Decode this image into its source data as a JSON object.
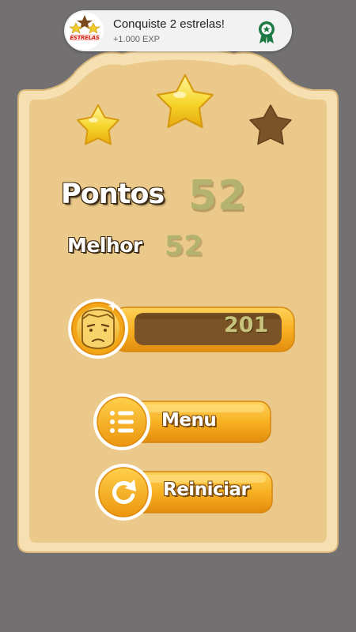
{
  "toast": {
    "logo_text": "ESTRELAS",
    "title": "Conquiste 2 estrelas!",
    "subtitle": "+1.000 EXP",
    "badge_icon": "award-ribbon-icon"
  },
  "result": {
    "stars_earned": 2,
    "stars_total": 3
  },
  "score": {
    "label": "Pontos",
    "value": "52"
  },
  "best": {
    "label": "Melhor",
    "value": "52"
  },
  "coins": {
    "value": "201",
    "icon": "coin-face-icon"
  },
  "buttons": {
    "menu_label": "Menu",
    "menu_icon": "list-icon",
    "restart_label": "Reiniciar",
    "restart_icon": "restart-icon"
  },
  "colors": {
    "background": "#727071",
    "panel": "#ebc98a",
    "panel_border": "#f4deaf",
    "score_value": "#b3b36f",
    "button_orange": "#f4a81a",
    "star_gold": "#f6d52a",
    "star_empty": "#7a5328"
  }
}
